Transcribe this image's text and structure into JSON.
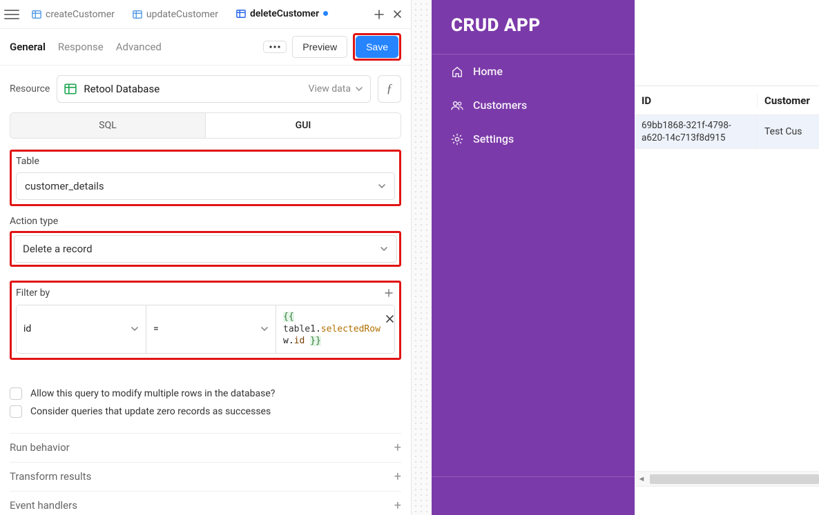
{
  "tabs": [
    {
      "label": "createCustomer"
    },
    {
      "label": "updateCustomer"
    },
    {
      "label": "deleteCustomer"
    }
  ],
  "subnav": {
    "general": "General",
    "response": "Response",
    "advanced": "Advanced",
    "preview": "Preview",
    "save": "Save"
  },
  "resource": {
    "label": "Resource",
    "name": "Retool Database",
    "view_data": "View data"
  },
  "mode_tabs": {
    "sql": "SQL",
    "gui": "GUI"
  },
  "table_field": {
    "label": "Table",
    "value": "customer_details"
  },
  "action_field": {
    "label": "Action type",
    "value": "Delete a record"
  },
  "filter": {
    "label": "Filter by",
    "key": "id",
    "op": "=",
    "expr_open": "{{",
    "expr_obj": "table1",
    "expr_dot1": ".",
    "expr_prop1": "selectedRow",
    "expr_dot2": ".",
    "expr_prop2": "id",
    "expr_close": "}}"
  },
  "opts": {
    "multi": "Allow this query to modify multiple rows in the database?",
    "zero": "Consider queries that update zero records as successes"
  },
  "sections": {
    "run": "Run behavior",
    "transform": "Transform results",
    "events": "Event handlers"
  },
  "app": {
    "title": "CRUD APP",
    "nav": {
      "home": "Home",
      "customers": "Customers",
      "settings": "Settings"
    },
    "table": {
      "head_id": "ID",
      "head_customer": "Customer",
      "row_id": "69bb1868-321f-4798-a620-14c713f8d915",
      "row_customer": "Test Cus"
    }
  }
}
